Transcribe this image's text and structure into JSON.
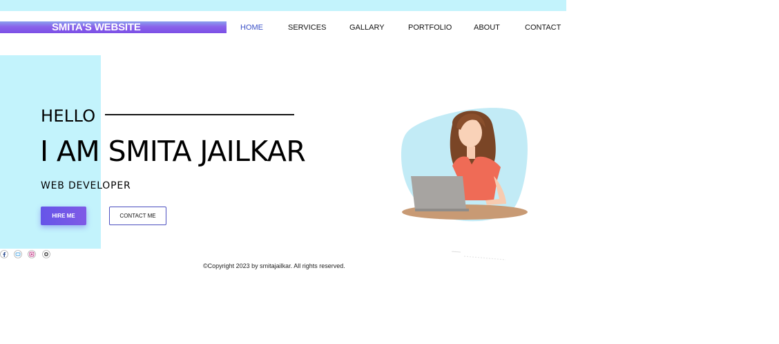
{
  "header": {
    "logo": "SMITA'S WEBSITE",
    "nav": [
      {
        "label": "HOME",
        "active": true
      },
      {
        "label": "SERVICES",
        "active": false
      },
      {
        "label": "GALLARY",
        "active": false
      },
      {
        "label": "PORTFOLIO",
        "active": false
      },
      {
        "label": "ABOUT",
        "active": false
      },
      {
        "label": "CONTACT",
        "active": false
      }
    ]
  },
  "hero": {
    "greeting": "HELLO",
    "name": "I AM SMITA JAILKAR",
    "role": "WEB DEVELOPER",
    "hire_button": "HIRE ME",
    "contact_button": "CONTACT ME",
    "illustration": "woman-with-laptop-illustration"
  },
  "social": [
    "facebook-icon",
    "twitter-icon",
    "instagram-icon",
    "github-icon"
  ],
  "footer": {
    "copyright": "©Copyright 2023 by smitajailkar. All rights reserved."
  },
  "colors": {
    "accent_cyan": "#c3f3fc",
    "accent_purple": "#7b4fe6",
    "nav_active": "#3c52c8"
  }
}
